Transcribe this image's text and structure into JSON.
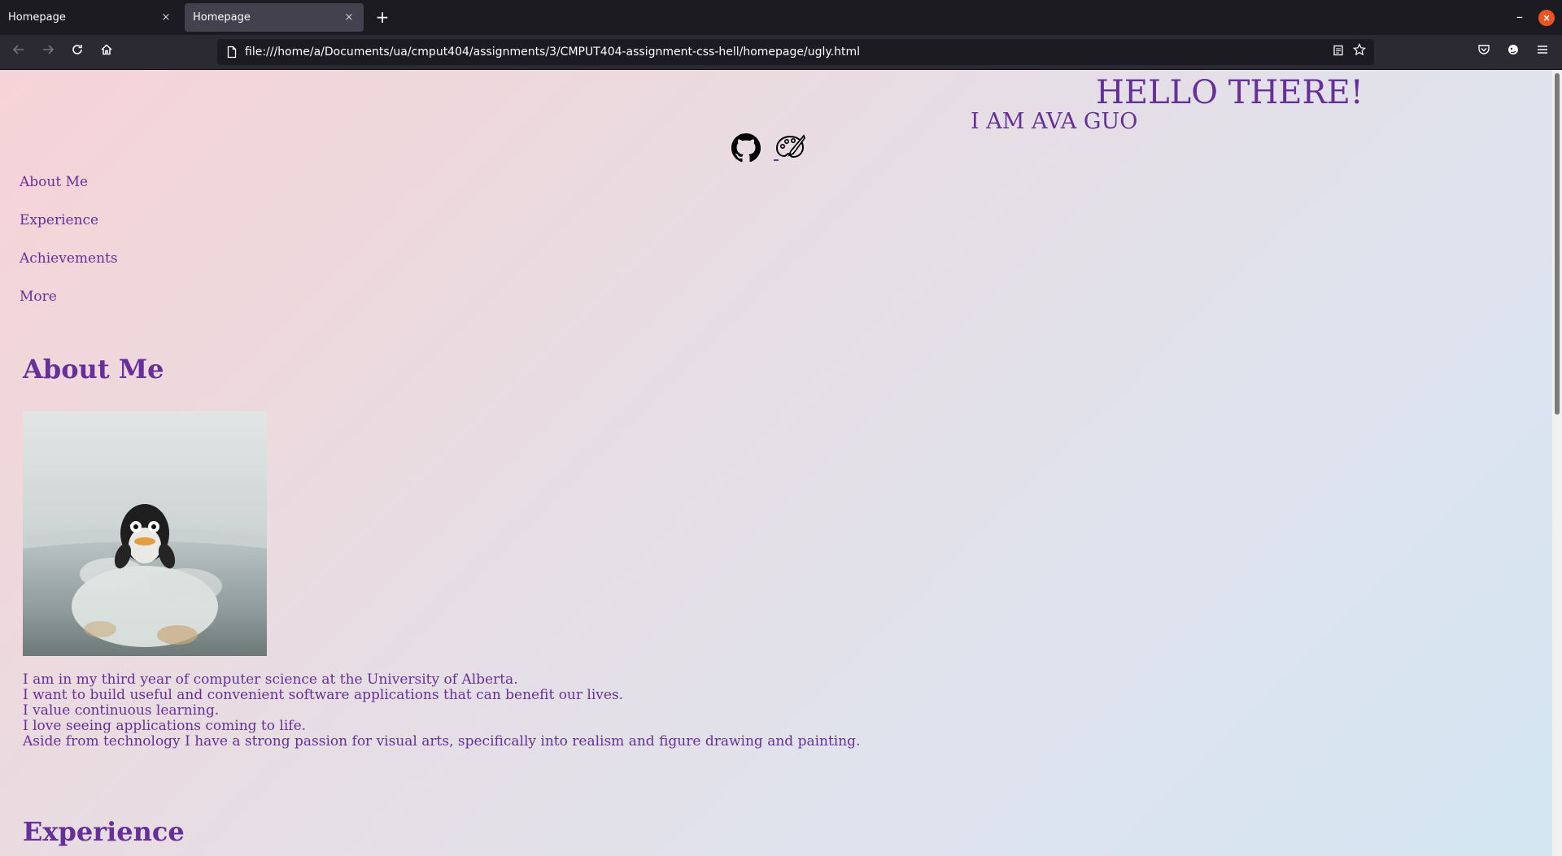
{
  "browser": {
    "tabs": [
      {
        "title": "Homepage",
        "close": "×"
      },
      {
        "title": "Homepage",
        "close": "×"
      }
    ],
    "new_tab": "+",
    "window": {
      "minimize": "–",
      "close": "×"
    },
    "url": "file:///home/a/Documents/ua/cmput404/assignments/3/CMPUT404-assignment-css-hell/homepage/ugly.html",
    "nav_icons": [
      "back-icon",
      "forward-icon",
      "reload-icon",
      "home-icon"
    ],
    "right_icons": [
      "pocket-icon",
      "extension-icon",
      "menu-icon"
    ]
  },
  "header": {
    "greeting": "HELLO THERE!",
    "name": "I AM AVA GUO"
  },
  "social_icons": [
    "github-icon",
    "art-palette-icon"
  ],
  "nav": {
    "items": [
      "About Me",
      "Experience",
      "Achievements",
      "More"
    ]
  },
  "about": {
    "heading": "About Me",
    "photo_alt": "penguin figurine in a glass",
    "lines": [
      "I am in my third year of computer science at the University of Alberta.",
      "I want to build useful and convenient software applications that can benefit our lives.",
      "I value continuous learning.",
      "I love seeing applications coming to life.",
      "Aside from technology I have a strong passion for visual arts, specifically into realism and figure drawing and painting."
    ]
  },
  "experience": {
    "heading": "Experience"
  },
  "colors": {
    "accent": "#66309a",
    "gradient_start": "#f6d3d6",
    "gradient_end": "#d3e6f2"
  }
}
